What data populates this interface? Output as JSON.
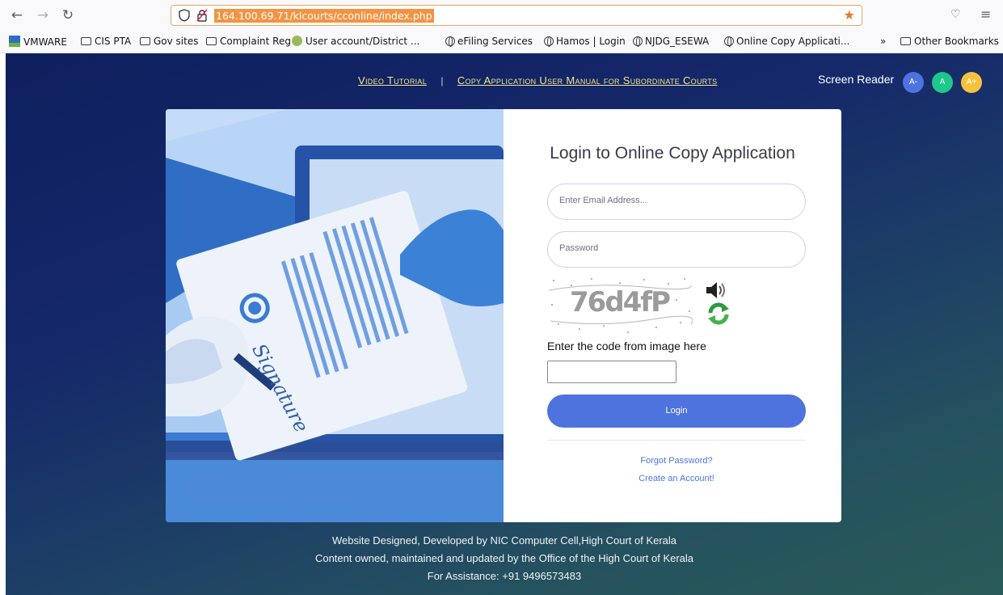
{
  "browser": {
    "url": "164.100.69.71/klcourts/cconline/index.php",
    "bookmarks": [
      {
        "label": "VMWARE",
        "icon": "vmware-icon"
      },
      {
        "label": "CIS PTA",
        "icon": "folder-icon"
      },
      {
        "label": "Gov sites",
        "icon": "folder-icon"
      },
      {
        "label": "Complaint Reg",
        "icon": "folder-icon"
      },
      {
        "label": "User account/District ...",
        "icon": "site-icon"
      },
      {
        "label": "eFiling Services",
        "icon": "globe-icon"
      },
      {
        "label": "Hamos | Login",
        "icon": "globe-icon"
      },
      {
        "label": "NJDG_ESEWA",
        "icon": "globe-icon"
      },
      {
        "label": "Online Copy Applicati...",
        "icon": "globe-icon"
      }
    ],
    "overflow_label": "»",
    "other_bookmarks": "Other Bookmarks"
  },
  "topnav": {
    "video_tutorial": "Video Tutorial",
    "separator": "|",
    "user_manual": "Copy Application User Manual for Subordinate Courts",
    "screen_reader": "Screen Reader",
    "font_small": "A-",
    "font_normal": "A",
    "font_large": "A+"
  },
  "colors": {
    "font_small_bg": "#4e73df",
    "font_normal_bg": "#1cc88a",
    "font_large_bg": "#f6c23e",
    "login_button": "#4e73df"
  },
  "login": {
    "title": "Login to Online Copy Application",
    "email_placeholder": "Enter Email Address...",
    "password_placeholder": "Password",
    "captcha_text": "76d4fP",
    "captcha_label": "Enter the code from image here",
    "captcha_value": "",
    "login_button": "Login",
    "forgot_password": "Forgot Password?",
    "create_account": "Create an Account!"
  },
  "illustration": {
    "signature_text": "Signature"
  },
  "footer": {
    "line1": "Website Designed, Developed by NIC Computer Cell,High Court of Kerala",
    "line2": "Content owned, maintained and updated by the Office of the High Court of Kerala",
    "line3": "For Assistance: +91 9496573483"
  }
}
